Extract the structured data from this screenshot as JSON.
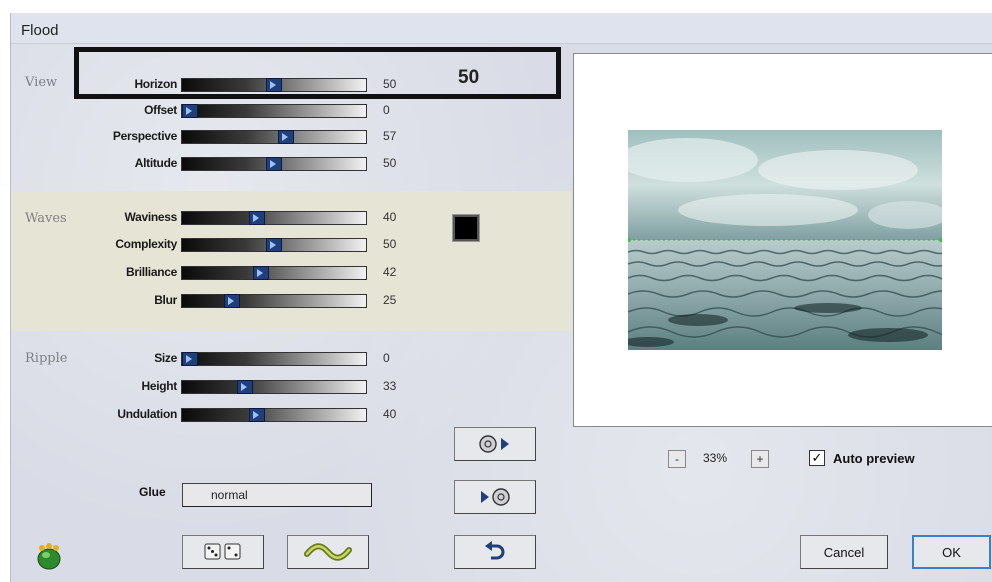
{
  "window": {
    "title": "Flood"
  },
  "sections": {
    "view": "View",
    "waves": "Waves",
    "ripple": "Ripple"
  },
  "sliders": [
    {
      "key": "horizon",
      "label": "Horizon",
      "value": "50",
      "fraction": 0.5
    },
    {
      "key": "offset",
      "label": "Offset",
      "value": "0",
      "fraction": 0.0
    },
    {
      "key": "perspective",
      "label": "Perspective",
      "value": "57",
      "fraction": 0.57
    },
    {
      "key": "altitude",
      "label": "Altitude",
      "value": "50",
      "fraction": 0.5
    },
    {
      "key": "waviness",
      "label": "Waviness",
      "value": "40",
      "fraction": 0.4
    },
    {
      "key": "complexity",
      "label": "Complexity",
      "value": "50",
      "fraction": 0.5
    },
    {
      "key": "brilliance",
      "label": "Brilliance",
      "value": "42",
      "fraction": 0.42
    },
    {
      "key": "blur",
      "label": "Blur",
      "value": "25",
      "fraction": 0.25
    },
    {
      "key": "size",
      "label": "Size",
      "value": "0",
      "fraction": 0.0
    },
    {
      "key": "height",
      "label": "Height",
      "value": "33",
      "fraction": 0.33
    },
    {
      "key": "undulation",
      "label": "Undulation",
      "value": "40",
      "fraction": 0.4
    }
  ],
  "highlight_value": "50",
  "glue": {
    "label": "Glue",
    "value": "normal"
  },
  "zoom": {
    "minus": "-",
    "value": "33%",
    "plus": "+"
  },
  "auto_preview": {
    "label": "Auto preview",
    "checked": true,
    "mark": "✓"
  },
  "buttons": {
    "cancel": "Cancel",
    "ok": "OK"
  },
  "icons": {
    "preset_load": "disc-arrow-right-icon",
    "preset_save": "arrow-right-disc-icon",
    "reset": "reset-arrow-icon",
    "randomize": "dice-icon",
    "wave_mode": "wave-icon",
    "app_logo": "frog-logo-icon"
  },
  "colors": {
    "swatch": "#000000",
    "accent": "#1f3f7a"
  }
}
